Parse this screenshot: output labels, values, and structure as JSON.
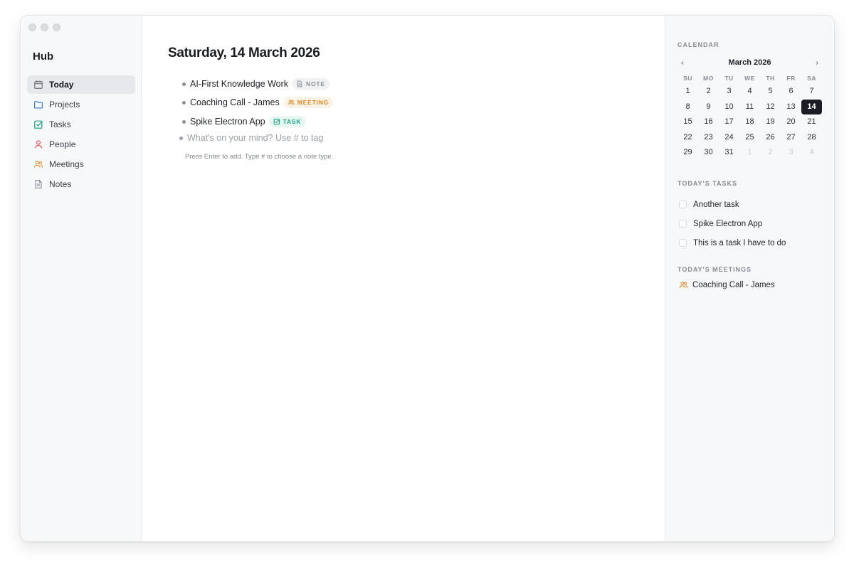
{
  "app": {
    "title": "Hub"
  },
  "sidebar": {
    "items": [
      {
        "label": "Today",
        "icon": "calendar-icon",
        "color": "#6b7078",
        "active": true
      },
      {
        "label": "Projects",
        "icon": "folder-icon",
        "color": "#2f7ed8"
      },
      {
        "label": "Tasks",
        "icon": "checkbox-icon",
        "color": "#1aa382"
      },
      {
        "label": "People",
        "icon": "person-icon",
        "color": "#e5484d"
      },
      {
        "label": "Meetings",
        "icon": "people-icon",
        "color": "#e08a2b"
      },
      {
        "label": "Notes",
        "icon": "document-icon",
        "color": "#8a8f96"
      }
    ]
  },
  "main": {
    "title": "Saturday, 14 March 2026",
    "entries": [
      {
        "text": "AI-First Knowledge Work",
        "tag": "NOTE",
        "tag_icon": "document-icon"
      },
      {
        "text": "Coaching Call - James",
        "tag": "MEETING",
        "tag_icon": "people-icon"
      },
      {
        "text": "Spike Electron App",
        "tag": "TASK",
        "tag_icon": "checkbox-icon"
      }
    ],
    "compose_placeholder": "What's on your mind? Use # to tag",
    "hint": "Press Enter to add. Type # to choose a note type."
  },
  "right": {
    "calendar_heading": "CALENDAR",
    "calendar": {
      "prev": "‹",
      "next": "›",
      "month": "March 2026",
      "weekdays": [
        "SU",
        "MO",
        "TU",
        "WE",
        "TH",
        "FR",
        "SA"
      ],
      "weeks": [
        [
          "1",
          "2",
          "3",
          "4",
          "5",
          "6",
          "7"
        ],
        [
          "8",
          "9",
          "10",
          "11",
          "12",
          "13",
          "14"
        ],
        [
          "15",
          "16",
          "17",
          "18",
          "19",
          "20",
          "21"
        ],
        [
          "22",
          "23",
          "24",
          "25",
          "26",
          "27",
          "28"
        ],
        [
          "29",
          "30",
          "31",
          "1",
          "2",
          "3",
          "4"
        ]
      ],
      "selected": "14"
    },
    "tasks_heading": "TODAY'S TASKS",
    "tasks": [
      "Another task",
      "Spike Electron App",
      "This is a task I have to do"
    ],
    "meetings_heading": "TODAY'S MEETINGS",
    "meetings": [
      "Coaching Call - James"
    ]
  },
  "colors": {
    "accent_dark": "#1a1d24",
    "note": "#8a8f96",
    "meeting": "#e08a2b",
    "task": "#1aa382"
  }
}
